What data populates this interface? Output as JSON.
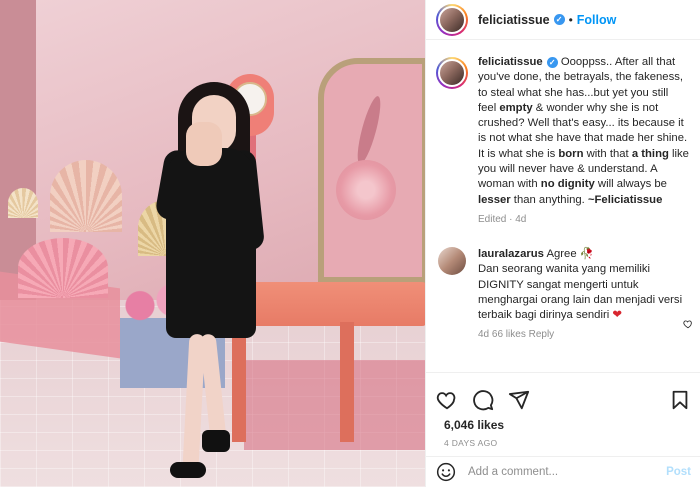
{
  "header": {
    "username": "feliciatissue",
    "separator": "•",
    "follow_label": "Follow",
    "verified_icon": "verified-check-icon"
  },
  "caption": {
    "username": "feliciatissue",
    "parts": [
      " Oooppss.. After all that you've done, the betrayals, the fakeness, to steal what she has...but yet you still feel ",
      "empty",
      " & wonder why she is not crushed? Well that's easy... its because it is not what she have that made her shine. It is what she is ",
      "born",
      " with that ",
      "a thing",
      " like you will never have & understand. A woman with ",
      "no dignity",
      " will always be ",
      "lesser",
      " than anything. ",
      "~Feliciatissue"
    ],
    "meta": "Edited · 4d"
  },
  "comment": {
    "username": "lauralazarus",
    "first_line": "Agree",
    "text": "Dan seorang wanita yang memiliki DIGNITY sangat mengerti untuk menghargai orang lain dan menjadi versi terbaik bagi dirinya sendiri",
    "emoji_end": "❤",
    "emoji_inline": "🥀",
    "time": "4d",
    "likes": "66 likes",
    "reply": "Reply"
  },
  "actions": {
    "icons": [
      "heart-icon",
      "comment-icon",
      "share-icon",
      "bookmark-icon"
    ]
  },
  "likes": "6,046 likes",
  "date": "4 DAYS AGO",
  "add_comment": {
    "placeholder": "Add a comment...",
    "post_label": "Post",
    "icon": "emoji-icon"
  },
  "colors": {
    "accent": "#0095f6",
    "verified": "#3897f0",
    "muted": "#8e8e8e",
    "heart": "#d8262f"
  }
}
